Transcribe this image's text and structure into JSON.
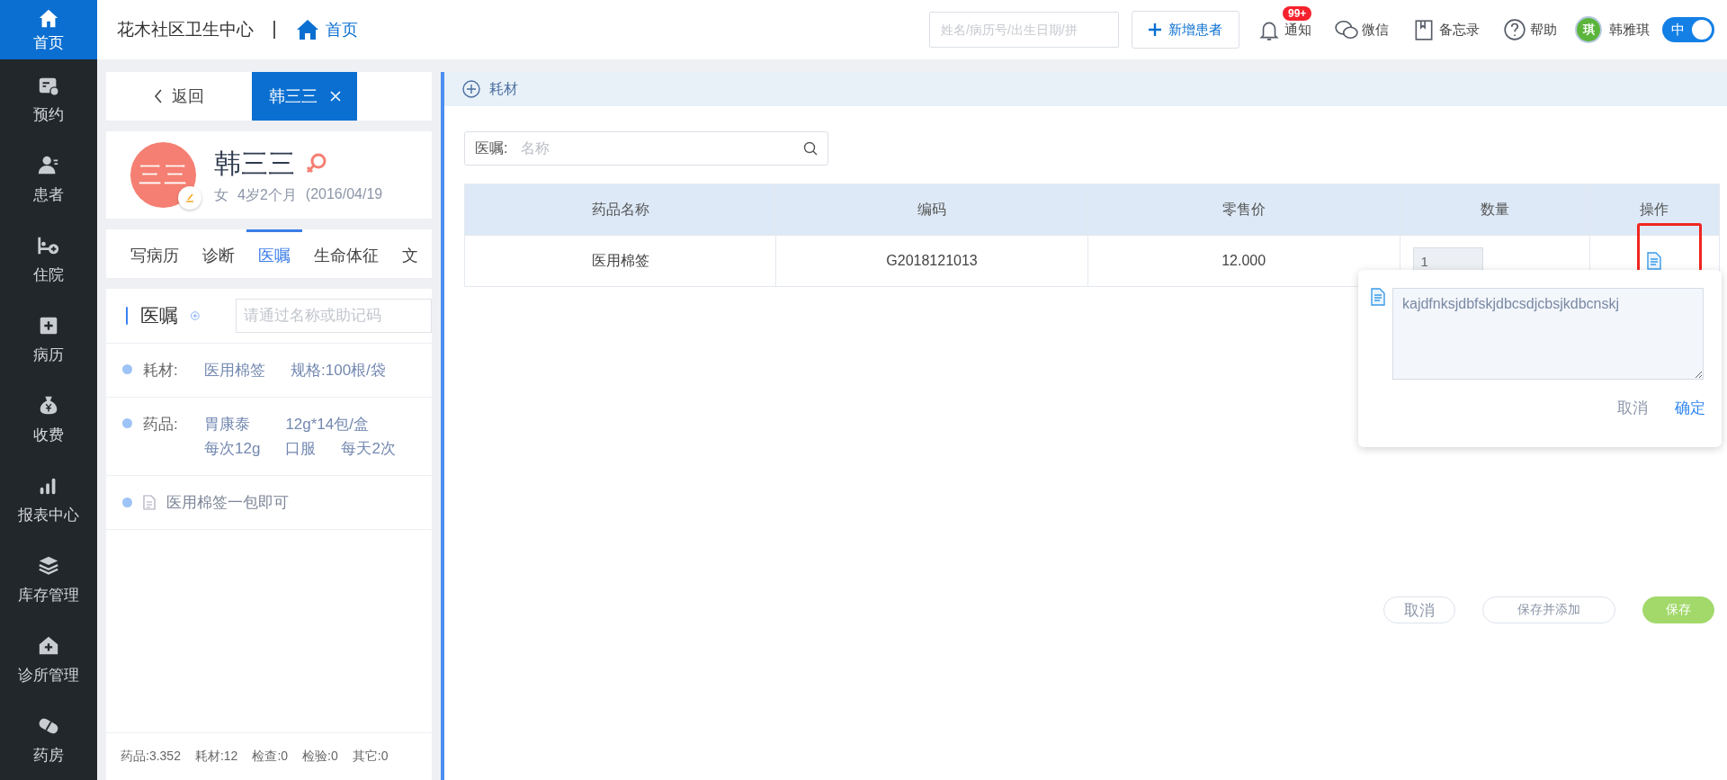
{
  "sidebar": {
    "items": [
      {
        "label": "首页",
        "kind": "home",
        "selected": true
      },
      {
        "label": "预约",
        "kind": "calendar",
        "selected": false
      },
      {
        "label": "患者",
        "kind": "person",
        "selected": false
      },
      {
        "label": "住院",
        "kind": "bed",
        "selected": false
      },
      {
        "label": "病历",
        "kind": "record",
        "selected": false
      },
      {
        "label": "收费",
        "kind": "money",
        "selected": false
      },
      {
        "label": "报表中心",
        "kind": "chart",
        "selected": false
      },
      {
        "label": "库存管理",
        "kind": "layers",
        "selected": false
      },
      {
        "label": "诊所管理",
        "kind": "clinic",
        "selected": false
      },
      {
        "label": "药房",
        "kind": "pill",
        "selected": false
      }
    ]
  },
  "top_bar": {
    "clinic_name": "花木社区卫生中心",
    "breadcrumb": "首页",
    "search": {
      "placeholder": "姓名/病历号/出生日期/拼"
    },
    "add_button": "新增患者",
    "tools": [
      {
        "label": "通知",
        "kind": "bell",
        "badge": "99+"
      },
      {
        "label": "微信",
        "kind": "wechat"
      },
      {
        "label": "备忘录",
        "kind": "book"
      },
      {
        "label": "帮助",
        "kind": "help"
      }
    ],
    "user": {
      "avatar_text": "琪",
      "name": "韩雅琪"
    },
    "language_toggle": {
      "label": "中",
      "on": true
    }
  },
  "patient_panel": {
    "back": "返回",
    "patient_tab": "韩三三",
    "patient": {
      "avatar_text": "三三",
      "name": "韩三三",
      "gender": "女",
      "age": "4岁2个月",
      "birth_date": "(2016/04/19"
    },
    "tabs": [
      {
        "label": "写病历",
        "selected": false
      },
      {
        "label": "诊断",
        "selected": false
      },
      {
        "label": "医嘱",
        "selected": true
      },
      {
        "label": "生命体征",
        "selected": false
      },
      {
        "label": "文",
        "selected": false
      }
    ],
    "orders": {
      "title": "医嘱",
      "search": {
        "placeholder": "请通过名称或助记码"
      },
      "items": [
        {
          "kind": "consumable",
          "category": "耗材:",
          "name": "医用棉签",
          "spec": "规格:100根/袋"
        },
        {
          "kind": "drug",
          "category": "药品:",
          "name": "胃康泰",
          "spec": "12g*14包/盒",
          "dose": "每次12g",
          "route": "口服",
          "frequency": "每天2次"
        },
        {
          "kind": "note",
          "text": "医用棉签一包即可"
        }
      ]
    },
    "totals": [
      "药品:3.352",
      "耗材:12",
      "检查:0",
      "检验:0",
      "其它:0"
    ]
  },
  "drawer": {
    "title": "耗材",
    "search": {
      "label": "医嘱:",
      "placeholder": "名称"
    },
    "table": {
      "columns": [
        "药品名称",
        "编码",
        "零售价",
        "数量",
        "操作"
      ],
      "rows": [
        {
          "cells": [
            "医用棉签",
            "G2018121013",
            "12.000"
          ],
          "quantity": "1"
        }
      ]
    },
    "note_popup": {
      "value": "kajdfnksjdbfskjdbcsdjcbsjkdbcnskj",
      "cancel": "取消",
      "confirm": "确定"
    },
    "buttons": [
      {
        "label": "取消",
        "kind": "cancel"
      },
      {
        "label": "保存并添加",
        "kind": "secondary"
      },
      {
        "label": "保存",
        "kind": "primary"
      }
    ]
  }
}
